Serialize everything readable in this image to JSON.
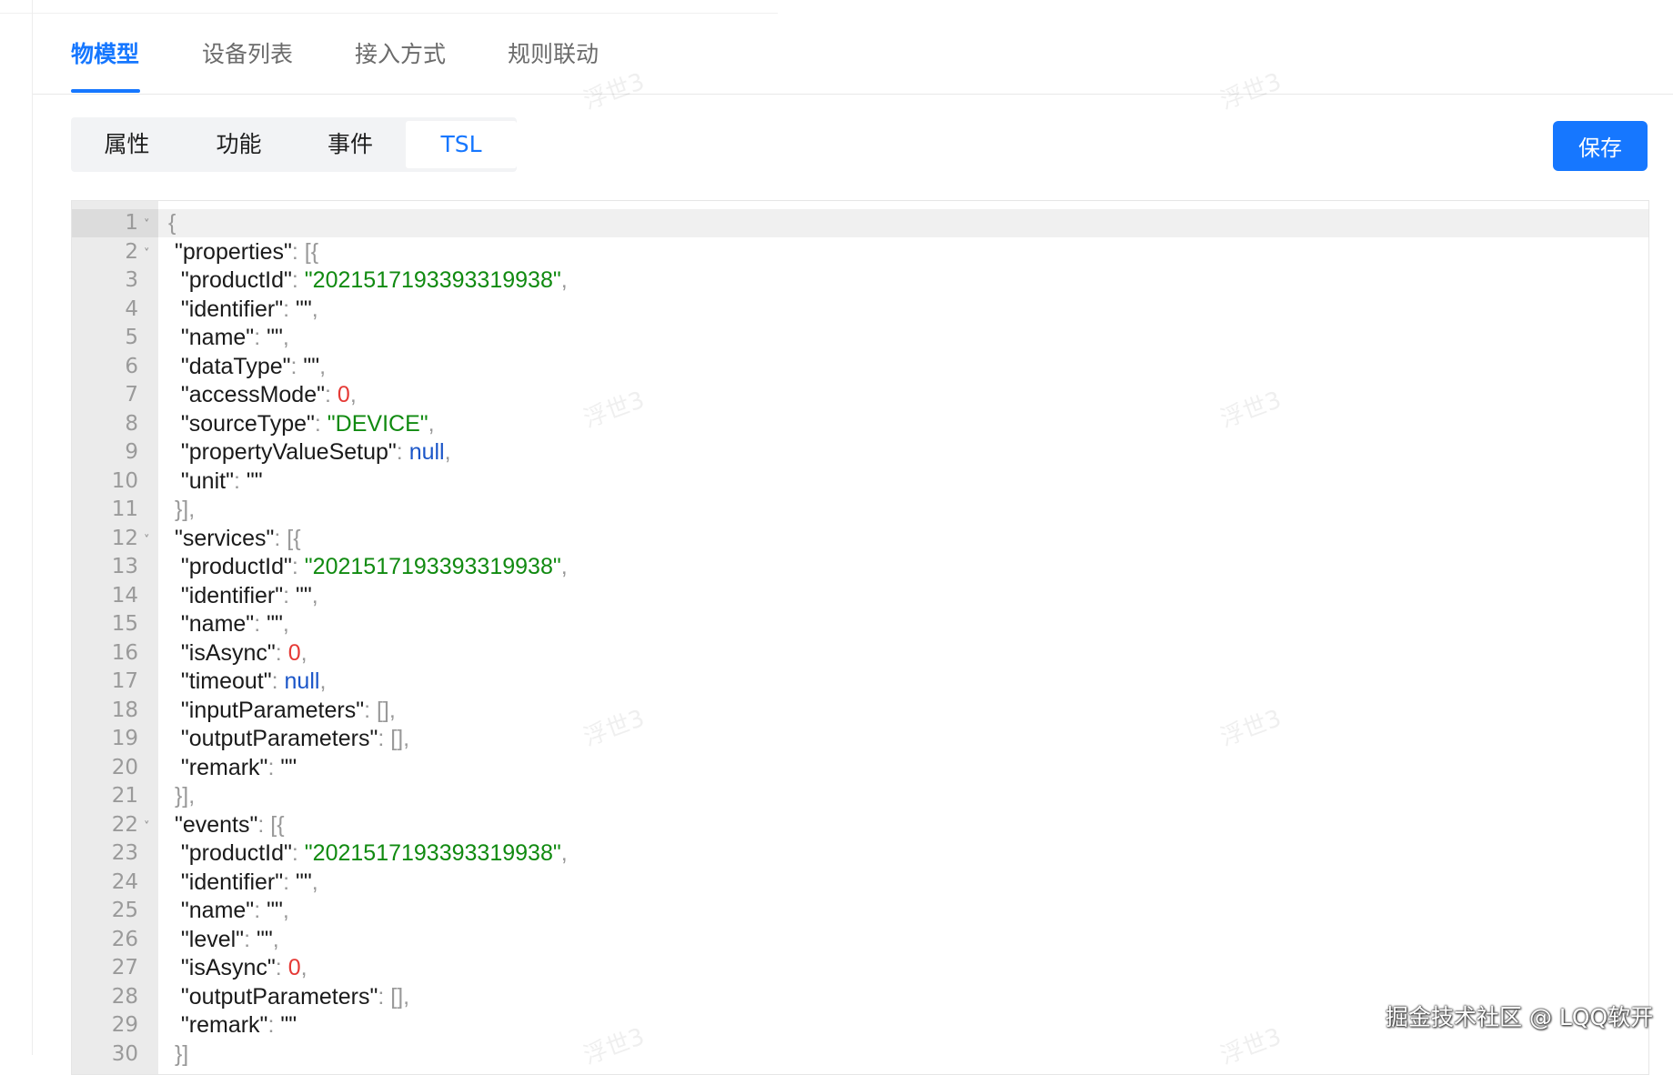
{
  "main_tabs": [
    {
      "label": "物模型",
      "active": true
    },
    {
      "label": "设备列表",
      "active": false
    },
    {
      "label": "接入方式",
      "active": false
    },
    {
      "label": "规则联动",
      "active": false
    }
  ],
  "sub_tabs": [
    {
      "label": "属性",
      "active": false
    },
    {
      "label": "功能",
      "active": false
    },
    {
      "label": "事件",
      "active": false
    },
    {
      "label": "TSL",
      "active": true
    }
  ],
  "save_label": "保存",
  "accent_color": "#1677ff",
  "watermark_text": "浮世3",
  "credit_text": "掘金技术社区 @ LQQ软开",
  "editor": {
    "active_line": 1,
    "lines": [
      {
        "n": "1",
        "fold": true,
        "code": [
          [
            "p",
            "{"
          ]
        ]
      },
      {
        "n": "2",
        "fold": true,
        "code": [
          [
            "t",
            " \"properties\""
          ],
          [
            "p",
            ": [{"
          ]
        ]
      },
      {
        "n": "3",
        "code": [
          [
            "t",
            "  \"productId\""
          ],
          [
            "p",
            ": "
          ],
          [
            "s",
            "\"2021517193393319938\""
          ],
          [
            "p",
            ","
          ]
        ]
      },
      {
        "n": "4",
        "code": [
          [
            "t",
            "  \"identifier\""
          ],
          [
            "p",
            ": "
          ],
          [
            "t",
            "\"\""
          ],
          [
            "p",
            ","
          ]
        ]
      },
      {
        "n": "5",
        "code": [
          [
            "t",
            "  \"name\""
          ],
          [
            "p",
            ": "
          ],
          [
            "t",
            "\"\""
          ],
          [
            "p",
            ","
          ]
        ]
      },
      {
        "n": "6",
        "code": [
          [
            "t",
            "  \"dataType\""
          ],
          [
            "p",
            ": "
          ],
          [
            "t",
            "\"\""
          ],
          [
            "p",
            ","
          ]
        ]
      },
      {
        "n": "7",
        "code": [
          [
            "t",
            "  \"accessMode\""
          ],
          [
            "p",
            ": "
          ],
          [
            "n",
            "0"
          ],
          [
            "p",
            ","
          ]
        ]
      },
      {
        "n": "8",
        "code": [
          [
            "t",
            "  \"sourceType\""
          ],
          [
            "p",
            ": "
          ],
          [
            "s",
            "\"DEVICE\""
          ],
          [
            "p",
            ","
          ]
        ]
      },
      {
        "n": "9",
        "code": [
          [
            "t",
            "  \"propertyValueSetup\""
          ],
          [
            "p",
            ": "
          ],
          [
            "k",
            "null"
          ],
          [
            "p",
            ","
          ]
        ]
      },
      {
        "n": "10",
        "code": [
          [
            "t",
            "  \"unit\""
          ],
          [
            "p",
            ": "
          ],
          [
            "t",
            "\"\""
          ]
        ]
      },
      {
        "n": "11",
        "code": [
          [
            "p",
            " }],"
          ]
        ]
      },
      {
        "n": "12",
        "fold": true,
        "code": [
          [
            "t",
            " \"services\""
          ],
          [
            "p",
            ": [{"
          ]
        ]
      },
      {
        "n": "13",
        "code": [
          [
            "t",
            "  \"productId\""
          ],
          [
            "p",
            ": "
          ],
          [
            "s",
            "\"2021517193393319938\""
          ],
          [
            "p",
            ","
          ]
        ]
      },
      {
        "n": "14",
        "code": [
          [
            "t",
            "  \"identifier\""
          ],
          [
            "p",
            ": "
          ],
          [
            "t",
            "\"\""
          ],
          [
            "p",
            ","
          ]
        ]
      },
      {
        "n": "15",
        "code": [
          [
            "t",
            "  \"name\""
          ],
          [
            "p",
            ": "
          ],
          [
            "t",
            "\"\""
          ],
          [
            "p",
            ","
          ]
        ]
      },
      {
        "n": "16",
        "code": [
          [
            "t",
            "  \"isAsync\""
          ],
          [
            "p",
            ": "
          ],
          [
            "n",
            "0"
          ],
          [
            "p",
            ","
          ]
        ]
      },
      {
        "n": "17",
        "code": [
          [
            "t",
            "  \"timeout\""
          ],
          [
            "p",
            ": "
          ],
          [
            "k",
            "null"
          ],
          [
            "p",
            ","
          ]
        ]
      },
      {
        "n": "18",
        "code": [
          [
            "t",
            "  \"inputParameters\""
          ],
          [
            "p",
            ": [],"
          ]
        ]
      },
      {
        "n": "19",
        "code": [
          [
            "t",
            "  \"outputParameters\""
          ],
          [
            "p",
            ": [],"
          ]
        ]
      },
      {
        "n": "20",
        "code": [
          [
            "t",
            "  \"remark\""
          ],
          [
            "p",
            ": "
          ],
          [
            "t",
            "\"\""
          ]
        ]
      },
      {
        "n": "21",
        "code": [
          [
            "p",
            " }],"
          ]
        ]
      },
      {
        "n": "22",
        "fold": true,
        "code": [
          [
            "t",
            " \"events\""
          ],
          [
            "p",
            ": [{"
          ]
        ]
      },
      {
        "n": "23",
        "code": [
          [
            "t",
            "  \"productId\""
          ],
          [
            "p",
            ": "
          ],
          [
            "s",
            "\"2021517193393319938\""
          ],
          [
            "p",
            ","
          ]
        ]
      },
      {
        "n": "24",
        "code": [
          [
            "t",
            "  \"identifier\""
          ],
          [
            "p",
            ": "
          ],
          [
            "t",
            "\"\""
          ],
          [
            "p",
            ","
          ]
        ]
      },
      {
        "n": "25",
        "code": [
          [
            "t",
            "  \"name\""
          ],
          [
            "p",
            ": "
          ],
          [
            "t",
            "\"\""
          ],
          [
            "p",
            ","
          ]
        ]
      },
      {
        "n": "26",
        "code": [
          [
            "t",
            "  \"level\""
          ],
          [
            "p",
            ": "
          ],
          [
            "t",
            "\"\""
          ],
          [
            "p",
            ","
          ]
        ]
      },
      {
        "n": "27",
        "code": [
          [
            "t",
            "  \"isAsync\""
          ],
          [
            "p",
            ": "
          ],
          [
            "n",
            "0"
          ],
          [
            "p",
            ","
          ]
        ]
      },
      {
        "n": "28",
        "code": [
          [
            "t",
            "  \"outputParameters\""
          ],
          [
            "p",
            ": [],"
          ]
        ]
      },
      {
        "n": "29",
        "code": [
          [
            "t",
            "  \"remark\""
          ],
          [
            "p",
            ": "
          ],
          [
            "t",
            "\"\""
          ]
        ]
      },
      {
        "n": "30",
        "code": [
          [
            "p",
            " }]"
          ]
        ]
      }
    ]
  }
}
